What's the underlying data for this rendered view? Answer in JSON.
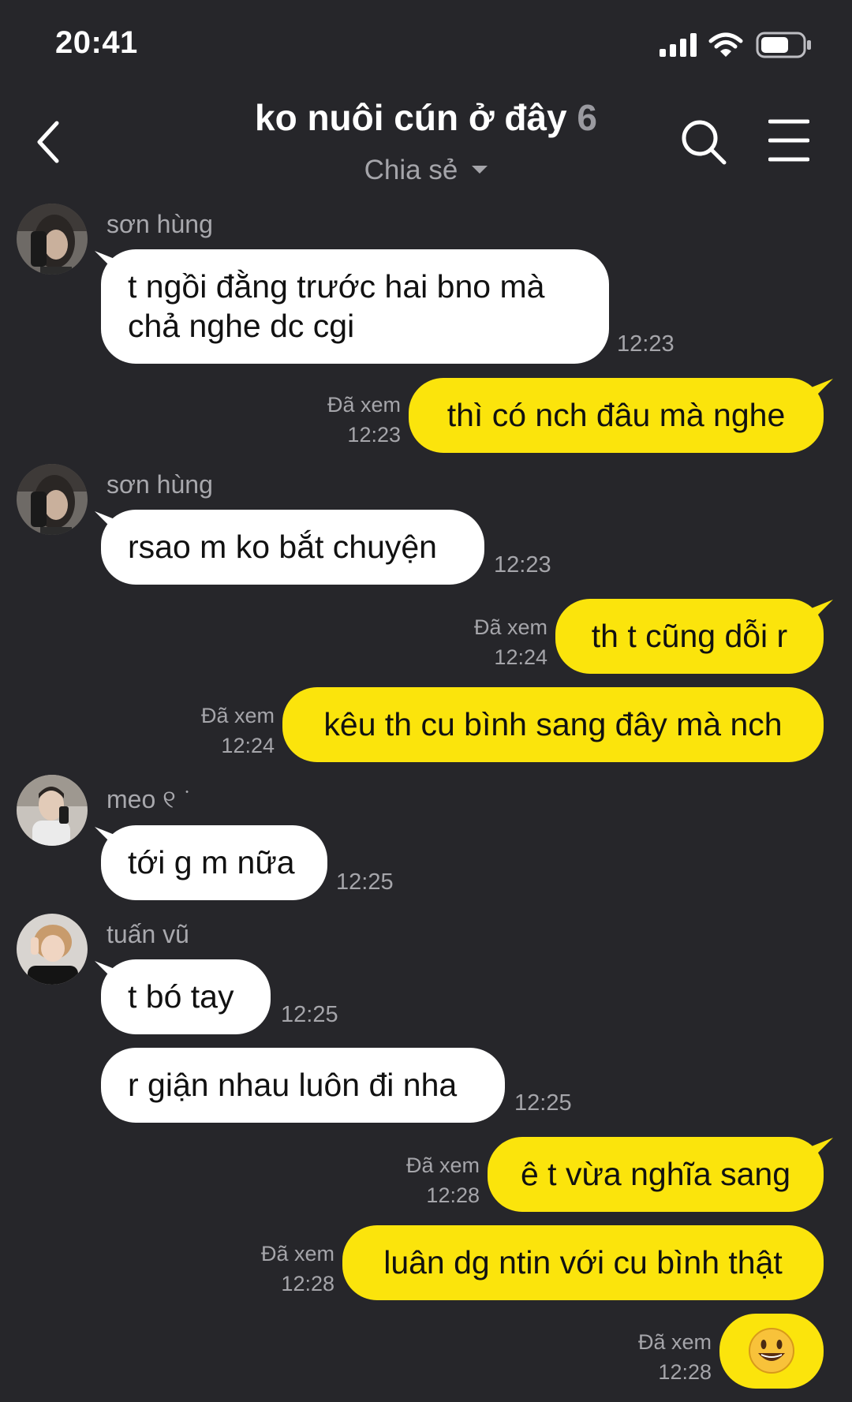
{
  "status_bar": {
    "time": "20:41"
  },
  "header": {
    "title": "ko nuôi cún ở đây",
    "member_count": "6",
    "subtitle": "Chia sẻ"
  },
  "messages": [
    {
      "sender": "sơn hùng",
      "lines": [
        "t ngồi đằng trước hai bno mà",
        "chả nghe dc cgi"
      ],
      "time": "12:23"
    },
    {
      "text": "thì có nch đâu mà nghe",
      "seen": "Đã xem",
      "time": "12:23"
    },
    {
      "sender": "sơn hùng",
      "text": "rsao m ko bắt chuyện",
      "time": "12:23"
    },
    {
      "text": "th t cũng dỗi r",
      "seen": "Đã xem",
      "time": "12:24"
    },
    {
      "text": "kêu th cu bình sang đây mà nch",
      "seen": "Đã xem",
      "time": "12:24"
    },
    {
      "sender": "meo ୧ ͘",
      "text": "tới g m nữa",
      "time": "12:25"
    },
    {
      "sender": "tuấn vũ",
      "text": "t bó tay",
      "time": "12:25"
    },
    {
      "text": "r giận nhau luôn đi nha",
      "time": "12:25"
    },
    {
      "text": "ê t vừa nghĩa sang",
      "seen": "Đã xem",
      "time": "12:28"
    },
    {
      "text": "luân dg ntin với cu bình thật",
      "seen": "Đã xem",
      "time": "12:28"
    },
    {
      "text": "😃",
      "seen": "Đã xem",
      "time": "12:28"
    }
  ],
  "colors": {
    "background": "#26262a",
    "outgoing_bubble": "#fbe40c",
    "incoming_bubble": "#ffffff"
  }
}
